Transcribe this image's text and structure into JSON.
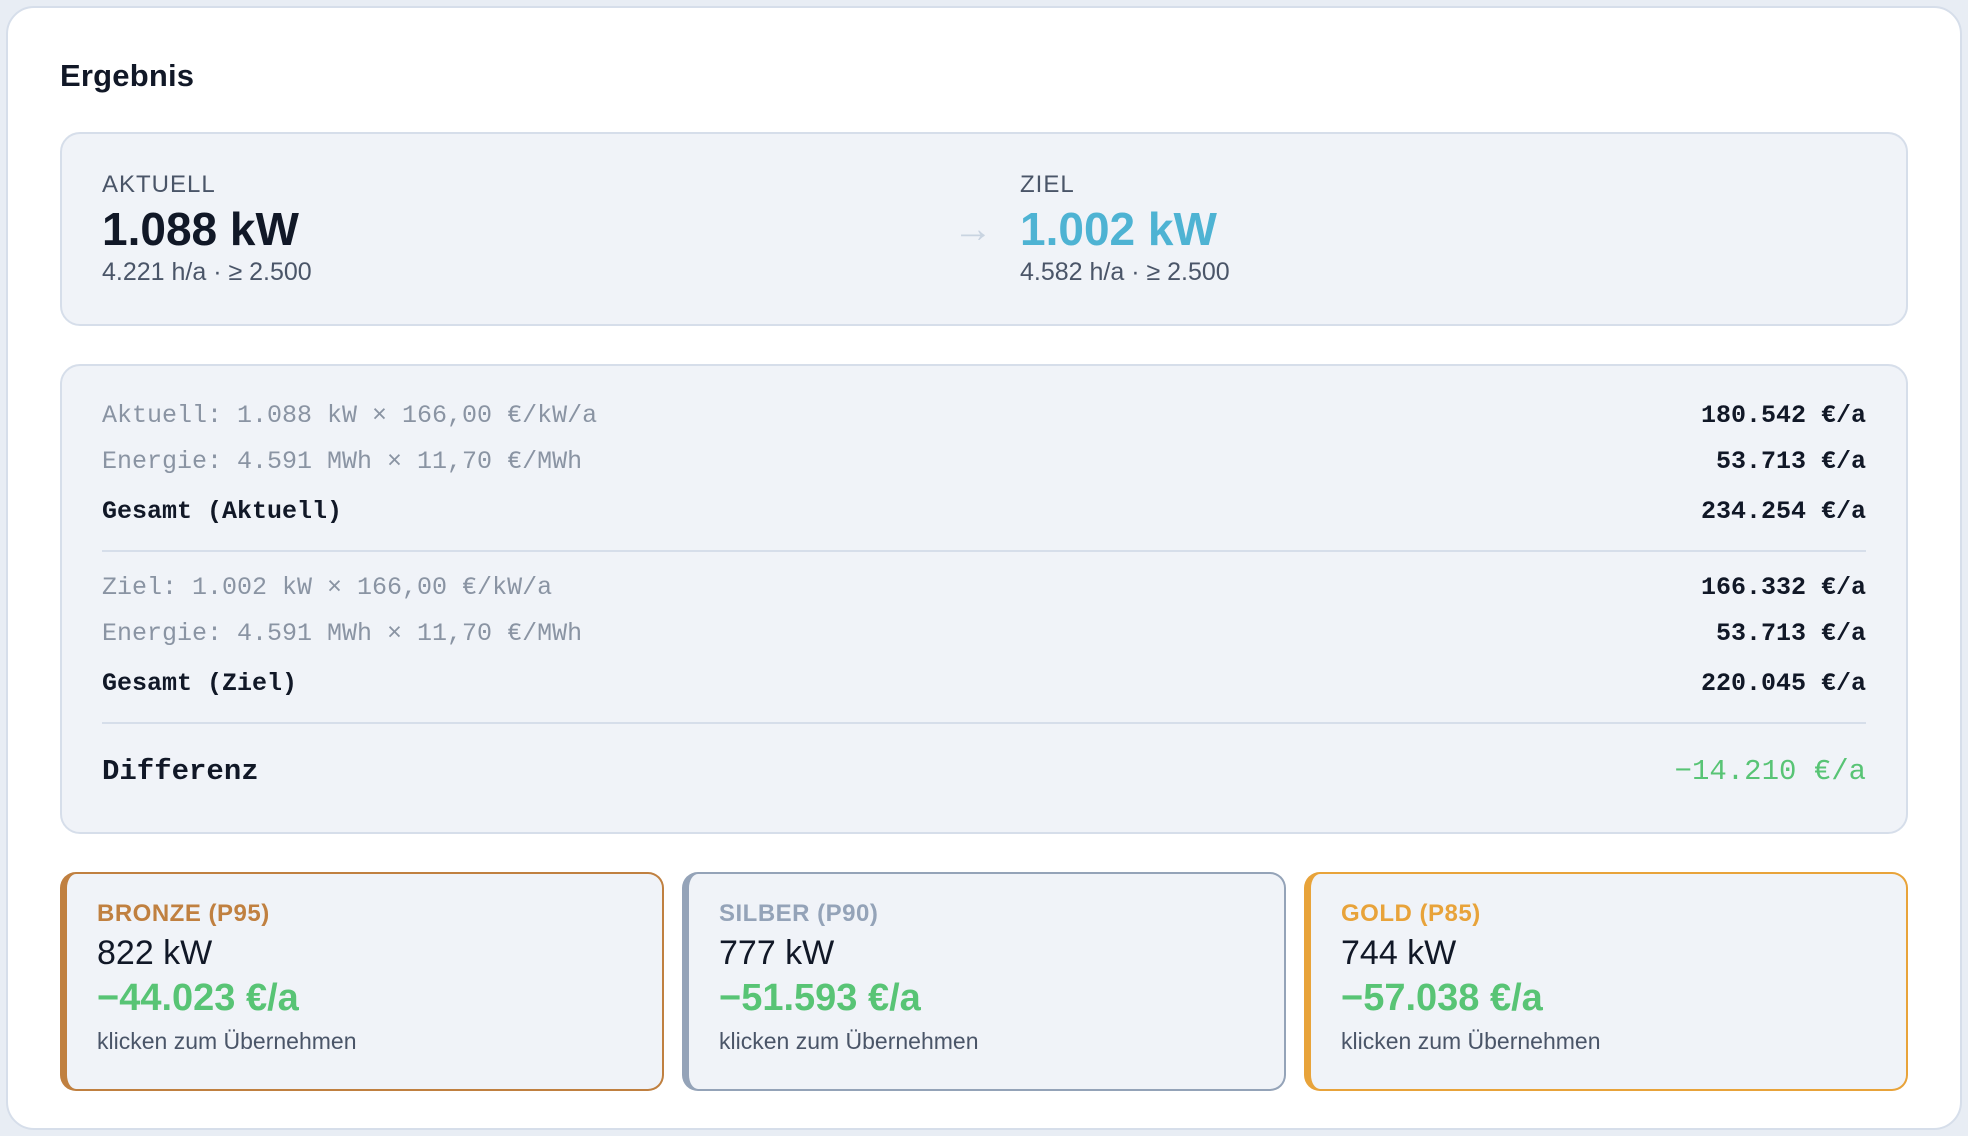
{
  "title": "Ergebnis",
  "summary": {
    "current": {
      "label": "AKTUELL",
      "value": "1.088 kW",
      "sub": "4.221 h/a · ≥ 2.500"
    },
    "arrow": "→",
    "target": {
      "label": "ZIEL",
      "value": "1.002 kW",
      "sub": "4.582 h/a · ≥ 2.500"
    }
  },
  "calc": {
    "current_power": {
      "label": "Aktuell: 1.088 kW × 166,00 €/kW/a",
      "value": "180.542 €/a"
    },
    "current_energy": {
      "label": "Energie: 4.591 MWh × 11,70 €/MWh",
      "value": "53.713 €/a"
    },
    "current_total": {
      "label": "Gesamt (Aktuell)",
      "value": "234.254 €/a"
    },
    "target_power": {
      "label": "Ziel: 1.002 kW × 166,00 €/kW/a",
      "value": "166.332 €/a"
    },
    "target_energy": {
      "label": "Energie: 4.591 MWh × 11,70 €/MWh",
      "value": "53.713 €/a"
    },
    "target_total": {
      "label": "Gesamt (Ziel)",
      "value": "220.045 €/a"
    },
    "difference": {
      "label": "Differenz",
      "value": "−14.210 €/a"
    }
  },
  "tiers": [
    {
      "name": "BRONZE (P95)",
      "kw": "822 kW",
      "savings": "−44.023 €/a",
      "hint": "klicken zum Übernehmen"
    },
    {
      "name": "SILBER (P90)",
      "kw": "777 kW",
      "savings": "−51.593 €/a",
      "hint": "klicken zum Übernehmen"
    },
    {
      "name": "GOLD (P85)",
      "kw": "744 kW",
      "savings": "−57.038 €/a",
      "hint": "klicken zum Übernehmen"
    }
  ],
  "colors": {
    "target_accent": "#4eb3d3",
    "savings_green": "#58c475",
    "bronze": "#c08040",
    "silver": "#94a3b8",
    "gold": "#e8a33a"
  }
}
